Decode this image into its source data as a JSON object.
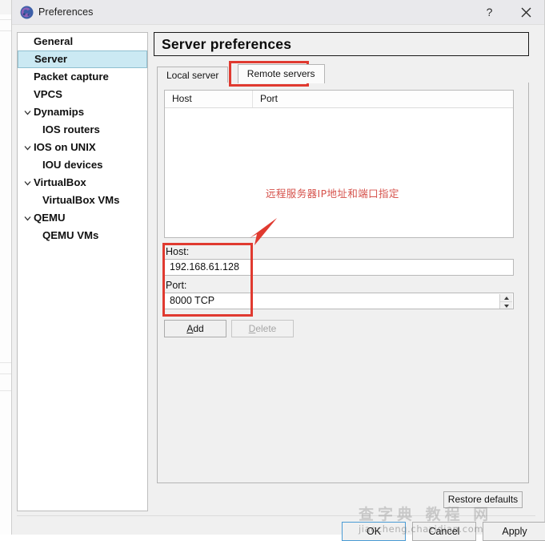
{
  "window": {
    "title": "Preferences",
    "icon": "gns3-logo-icon",
    "help_label": "?",
    "close_label": "×"
  },
  "sidebar": {
    "items": [
      {
        "label": "General",
        "level": 0,
        "expandable": false,
        "selected": false
      },
      {
        "label": "Server",
        "level": 0,
        "expandable": false,
        "selected": true
      },
      {
        "label": "Packet capture",
        "level": 0,
        "expandable": false,
        "selected": false
      },
      {
        "label": "VPCS",
        "level": 0,
        "expandable": false,
        "selected": false
      },
      {
        "label": "Dynamips",
        "level": 0,
        "expandable": true,
        "selected": false
      },
      {
        "label": "IOS routers",
        "level": 1,
        "expandable": false,
        "selected": false
      },
      {
        "label": "IOS on UNIX",
        "level": 0,
        "expandable": true,
        "selected": false
      },
      {
        "label": "IOU devices",
        "level": 1,
        "expandable": false,
        "selected": false
      },
      {
        "label": "VirtualBox",
        "level": 0,
        "expandable": true,
        "selected": false
      },
      {
        "label": "VirtualBox VMs",
        "level": 1,
        "expandable": false,
        "selected": false
      },
      {
        "label": "QEMU",
        "level": 0,
        "expandable": true,
        "selected": false
      },
      {
        "label": "QEMU VMs",
        "level": 1,
        "expandable": false,
        "selected": false
      }
    ]
  },
  "main": {
    "page_title": "Server preferences",
    "tabs": [
      {
        "label": "Local server",
        "active": false
      },
      {
        "label": "Remote servers",
        "active": true
      }
    ],
    "table": {
      "columns": [
        "Host",
        "Port"
      ],
      "rows": []
    },
    "annotation": "远程服务器IP地址和端口指定",
    "host": {
      "label": "Host:",
      "value": "192.168.61.128"
    },
    "port": {
      "label": "Port:",
      "value": "8000 TCP"
    },
    "add_button": {
      "label": "Add",
      "accel": "A",
      "enabled": true
    },
    "delete_button": {
      "label": "Delete",
      "accel": "D",
      "enabled": false
    },
    "restore_button": {
      "label": "Restore defaults"
    }
  },
  "footer": {
    "ok_label": "OK",
    "cancel_label": "Cancel",
    "apply_label": "Apply"
  },
  "watermark": {
    "cn": "查字典 教程 网",
    "url": "jiaocheng.chazidian.com"
  },
  "colors": {
    "accent": "#4a9bd4",
    "selection": "#cbe9f3",
    "annotation_red": "#e03a30",
    "annotation_text_red": "#d6524b"
  }
}
